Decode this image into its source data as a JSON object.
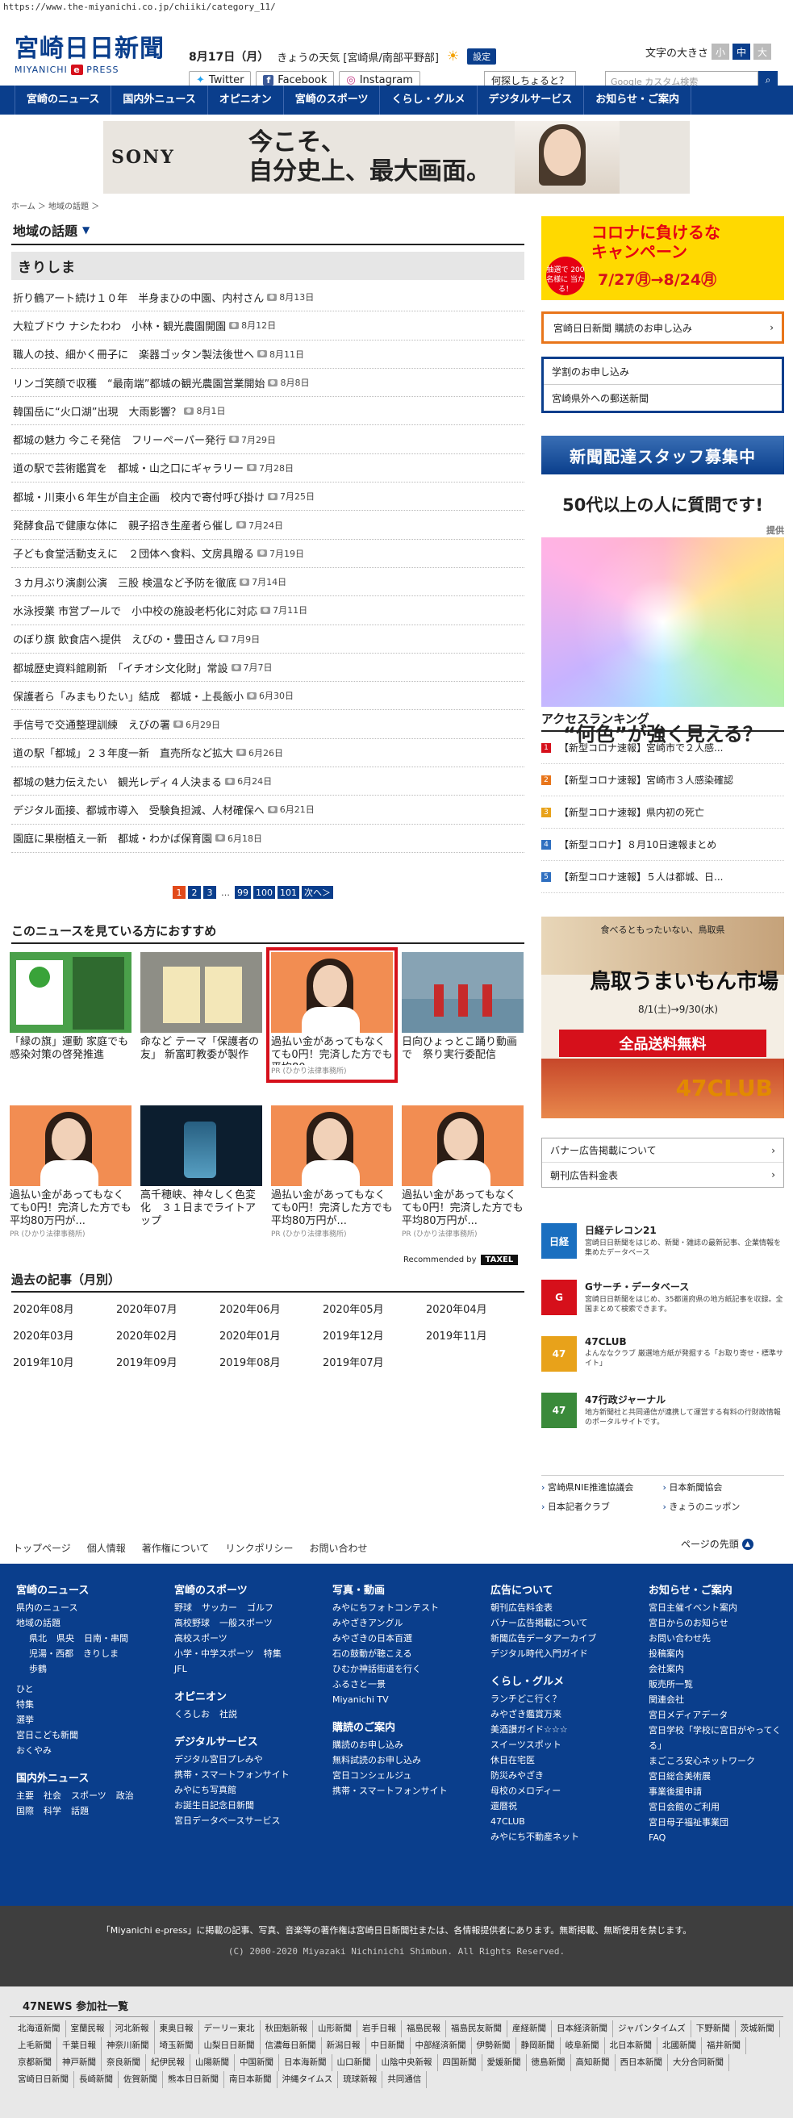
{
  "url": "https://www.the-miyanichi.co.jp/chiiki/category_11/",
  "header": {
    "logo_jp": "宮崎日日新聞",
    "logo_en_prefix": "MIYANICHI",
    "logo_en_e": "e",
    "logo_en_suffix": "PRESS",
    "date": "8月17日（月）",
    "weather_label": "きょうの天気",
    "weather_region": "[宮崎県/南部平野部]",
    "settings": "設定",
    "font_size_label": "文字の大きさ",
    "font_sizes": [
      "小",
      "中",
      "大"
    ],
    "twitter": "Twitter",
    "facebook": "Facebook",
    "instagram": "Instagram",
    "ask": "何探しちょると？",
    "search_placeholder": "Google カスタム検索"
  },
  "nav": [
    "宮崎のニュース",
    "国内外ニュース",
    "オピニオン",
    "宮崎のスポーツ",
    "くらし・グルメ",
    "デジタルサービス",
    "お知らせ・ご案内"
  ],
  "banner": {
    "brand": "SONY",
    "copy1": "今こそ、",
    "copy2": "自分史上、最大画面。"
  },
  "breadcrumb": "ホーム ＞ 地域の話題 ＞",
  "section_title": "地域の話題",
  "subsection": "きりしま",
  "articles": [
    {
      "title": "折り鶴アート続け１０年　半身まひの中園、内村さん",
      "date": "8月13日"
    },
    {
      "title": "大粒ブドウ ナシたわわ　小林・観光農園開園",
      "date": "8月12日"
    },
    {
      "title": "職人の技、細かく冊子に　楽器ゴッタン製法後世へ",
      "date": "8月11日"
    },
    {
      "title": "リンゴ笑顔で収穫　“最南端”都城の観光農園営業開始",
      "date": "8月8日"
    },
    {
      "title": "韓国岳に“火口湖”出現　大雨影響？",
      "date": "8月1日"
    },
    {
      "title": "都城の魅力 今こそ発信　フリーペーパー発行",
      "date": "7月29日"
    },
    {
      "title": "道の駅で芸術鑑賞を　都城・山之口にギャラリー",
      "date": "7月28日"
    },
    {
      "title": "都城・川東小６年生が自主企画　校内で寄付呼び掛け",
      "date": "7月25日"
    },
    {
      "title": "発酵食品で健康な体に　親子招き生産者ら催し",
      "date": "7月24日"
    },
    {
      "title": "子ども食堂活動支えに　２団体へ食料、文房具贈る",
      "date": "7月19日"
    },
    {
      "title": "３カ月ぶり演劇公演　三股 検温など予防を徹底",
      "date": "7月14日"
    },
    {
      "title": "水泳授業 市営プールで　小中校の施設老朽化に対応",
      "date": "7月11日"
    },
    {
      "title": "のぼり旗 飲食店へ提供　えびの・豊田さん",
      "date": "7月9日"
    },
    {
      "title": "都城歴史資料館刷新　「イチオシ文化財」常設",
      "date": "7月7日"
    },
    {
      "title": "保護者ら「みまもりたい」結成　都城・上長飯小",
      "date": "6月30日"
    },
    {
      "title": "手信号で交通整理訓練　えびの署",
      "date": "6月29日"
    },
    {
      "title": "道の駅「都城」２３年度一新　直売所など拡大",
      "date": "6月26日"
    },
    {
      "title": "都城の魅力伝えたい　観光レディ４人決まる",
      "date": "6月24日"
    },
    {
      "title": "デジタル面接、都城市導入　受験負担減、人材確保へ",
      "date": "6月21日"
    },
    {
      "title": "園庭に果樹植え一新　都城・わかば保育園",
      "date": "6月18日"
    }
  ],
  "pager": [
    "1",
    "2",
    "3",
    "…",
    "99",
    "100",
    "101",
    "次へ＞"
  ],
  "recommend": {
    "title": "このニュースを見ている方におすすめ",
    "items": [
      {
        "title": "「緑の旗」運動 家庭でも　感染対策の啓発推進",
        "pr": ""
      },
      {
        "title": "命など テーマ「保護者の友」 新富町教委が製作",
        "pr": ""
      },
      {
        "title": "過払い金があってもなくても0円！完済した方でも平均80...",
        "pr": "PR (ひかり法律事務所)"
      },
      {
        "title": "日向ひょっとこ踊り動画で　祭り実行委配信",
        "pr": ""
      },
      {
        "title": "過払い金があってもなくても0円！完済した方でも平均80万円が...",
        "pr": "PR (ひかり法律事務所)"
      },
      {
        "title": "高千穂峡、神々しく色変化　３１日までライトアップ",
        "pr": ""
      },
      {
        "title": "過払い金があってもなくても0円！完済した方でも平均80万円が...",
        "pr": "PR (ひかり法律事務所)"
      },
      {
        "title": "過払い金があってもなくても0円！完済した方でも平均80万円が...",
        "pr": "PR (ひかり法律事務所)"
      }
    ],
    "recommended_by": "Recommended by",
    "recommender": "TAXEL"
  },
  "archive": {
    "title": "過去の記事（月別）",
    "months": [
      "2020年08月",
      "2020年07月",
      "2020年06月",
      "2020年05月",
      "2020年04月",
      "2020年03月",
      "2020年02月",
      "2020年01月",
      "2019年12月",
      "2019年11月",
      "2019年10月",
      "2019年09月",
      "2019年08月",
      "2019年07月"
    ]
  },
  "sidebar": {
    "campaign_title1": "コロナに負けるな",
    "campaign_title2": "キャンペーン",
    "campaign_badge": "抽選で 200名様に 当たる！",
    "campaign_dates": "7/27㊊→8/24㊊",
    "subscribe": "宮崎日日新聞 購読のお申し込み",
    "study": "学割のお申し込み",
    "mail": "宮崎県外への郵送新聞",
    "staff": "新聞配達スタッフ募集中",
    "ad_q1": "50代以上の人に質問です!",
    "ad_q2": "“何色”が強く見える？",
    "ad_provider": "提供",
    "ranking_title": "アクセスランキング",
    "ranking": [
      {
        "no": "1",
        "title": "【新型コロナ速報】宮崎市で２人感...",
        "color": "#d6101b"
      },
      {
        "no": "2",
        "title": "【新型コロナ速報】宮崎市３人感染確認",
        "color": "#e8751a"
      },
      {
        "no": "3",
        "title": "【新型コロナ速報】県内初の死亡",
        "color": "#e8a21a"
      },
      {
        "no": "4",
        "title": "【新型コロナ】８月10日速報まとめ",
        "color": "#2f6fc0"
      },
      {
        "no": "5",
        "title": "【新型コロナ速報】５人は都城、日...",
        "color": "#2f6fc0"
      }
    ],
    "tottori_catch": "食べるともったいない、鳥取県",
    "tottori_title": "鳥取うまいもん市場",
    "tottori_dates": "8/1(土)→9/30(水)",
    "tottori_free": "全品送料無料",
    "tottori_47": "47CLUB",
    "links": [
      "バナー広告掲載について",
      "朝刊広告料金表"
    ],
    "services": [
      {
        "name": "日経テレコン21",
        "desc": "宮崎日日新聞をはじめ、新聞・雑誌の最新記事、企業情報を集めたデータベース",
        "color": "#1a6fc0",
        "logo": "日経"
      },
      {
        "name": "Gサーチ・データベース",
        "desc": "宮崎日日新聞をはじめ、35都道府県の地方紙記事を収録。全国まとめて検索できます。",
        "color": "#d6101b",
        "logo": "G"
      },
      {
        "name": "47CLUB",
        "desc": "よんななクラブ 厳選地方紙が発掘する「お取り寄せ・標準サイト」",
        "color": "#e8a21a",
        "logo": "47"
      },
      {
        "name": "47行政ジャーナル",
        "desc": "地方新聞社と共同通信が連携して運営する有料の行財政情報のポータルサイトです。",
        "color": "#3a8a3a",
        "logo": "47"
      }
    ],
    "side_links": [
      "宮崎県NIE推進協議会",
      "日本新聞協会",
      "日本記者クラブ",
      "きょうのニッポン"
    ]
  },
  "footer": {
    "top_links": [
      "トップページ",
      "個人情報",
      "著作権について",
      "リンクポリシー",
      "お問い合わせ"
    ],
    "page_top": "ページの先頭",
    "col1": {
      "h": "宮崎のニュース",
      "items": [
        "県内のニュース",
        "地域の話題"
      ],
      "tags": [
        "県北",
        "県央",
        "日南・串間",
        "児湯・西都",
        "きりしま",
        "歩鶴"
      ],
      "items2": [
        "ひと",
        "特集",
        "選挙",
        "宮日こども新聞",
        "おくやみ"
      ],
      "h2": "国内外ニュース",
      "tags2": [
        "主要",
        "社会",
        "スポーツ",
        "政治",
        "国際",
        "科学",
        "話題"
      ]
    },
    "col2": {
      "h": "宮崎のスポーツ",
      "tags": [
        "野球",
        "サッカー",
        "ゴルフ",
        "高校野球",
        "一般スポーツ",
        "高校スポーツ",
        "小学・中学スポーツ",
        "特集",
        "JFL"
      ],
      "h2": "オピニオン",
      "tags2": [
        "くろしお",
        "社説"
      ],
      "h3": "デジタルサービス",
      "items3": [
        "デジタル宮日プレみや",
        "携帯・スマートフォンサイト",
        "みやにち写真館",
        "お誕生日記念日新聞",
        "宮日データベースサービス"
      ]
    },
    "col3": {
      "h": "写真・動画",
      "items": [
        "みやにちフォトコンテスト",
        "みやざきアングル",
        "みやざきの日本百選",
        "石の鼓動が聴こえる",
        "ひむか神話街道を行く",
        "ふるさと一景",
        "Miyanichi TV"
      ],
      "h2": "購読のご案内",
      "items2": [
        "購読のお申し込み",
        "無料試読のお申し込み",
        "宮日コンシェルジュ",
        "携帯・スマートフォンサイト"
      ]
    },
    "col4": {
      "h": "広告について",
      "items": [
        "朝刊広告料金表",
        "バナー広告掲載について",
        "新聞広告データアーカイブ",
        "デジタル時代入門ガイド"
      ],
      "h2": "くらし・グルメ",
      "items2": [
        "ランチどこ行く？",
        "みやざき鑑賞万来",
        "美酒讃ガイド☆☆☆",
        "スイーツスポット",
        "休日在宅医",
        "防災みやざき",
        "母校のメロディー",
        "還暦祝",
        "47CLUB",
        "みやにち不動産ネット"
      ]
    },
    "col5": {
      "h": "お知らせ・ご案内",
      "items": [
        "宮日主催イベント案内",
        "宮日からのお知らせ",
        "お問い合わせ先",
        "投稿案内",
        "会社案内",
        "販売所一覧",
        "関連会社",
        "宮日メディアデータ",
        "宮日学校「学校に宮日がやってくる」",
        "まごころ安心ネットワーク",
        "宮日総合美術展",
        "事業後援申請",
        "宮日会館のご利用",
        "宮日母子福祉事業団",
        "FAQ"
      ]
    },
    "copy1": "「Miyanichi e-press」に掲載の記事、写真、音楽等の著作権は宮崎日日新聞社または、各情報提供者にあります。無断掲載、無断使用を禁じます。",
    "copy2": "(C) 2000-2020 Miyazaki Nichinichi Shimbun. All Rights Reserved.",
    "n47_title": "47NEWS 参加社一覧",
    "n47": [
      "北海道新聞",
      "室蘭民報",
      "河北新報",
      "東奥日報",
      "デーリー東北",
      "秋田魁新報",
      "山形新聞",
      "岩手日報",
      "福島民報",
      "福島民友新聞",
      "産経新聞",
      "日本経済新聞",
      "ジャパンタイムズ",
      "下野新聞",
      "茨城新聞",
      "上毛新聞",
      "千葉日報",
      "神奈川新聞",
      "埼玉新聞",
      "山梨日日新聞",
      "信濃毎日新聞",
      "新潟日報",
      "中日新聞",
      "中部経済新聞",
      "伊勢新聞",
      "静岡新聞",
      "岐阜新聞",
      "北日本新聞",
      "北國新聞",
      "福井新聞",
      "京都新聞",
      "神戸新聞",
      "奈良新聞",
      "紀伊民報",
      "山陽新聞",
      "中国新聞",
      "日本海新聞",
      "山口新聞",
      "山陰中央新報",
      "四国新聞",
      "愛媛新聞",
      "徳島新聞",
      "高知新聞",
      "西日本新聞",
      "大分合同新聞",
      "宮崎日日新聞",
      "長崎新聞",
      "佐賀新聞",
      "熊本日日新聞",
      "南日本新聞",
      "沖縄タイムス",
      "琉球新報",
      "共同通信"
    ]
  }
}
